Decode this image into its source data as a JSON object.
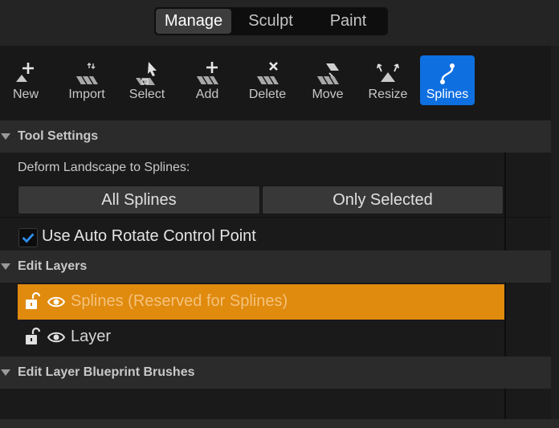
{
  "modes": {
    "items": [
      {
        "label": "Manage",
        "active": true
      },
      {
        "label": "Sculpt",
        "active": false
      },
      {
        "label": "Paint",
        "active": false
      }
    ]
  },
  "tools": [
    {
      "label": "New",
      "icon": "new-icon",
      "active": false
    },
    {
      "label": "Import",
      "icon": "import-icon",
      "active": false
    },
    {
      "label": "Select",
      "icon": "select-icon",
      "active": false
    },
    {
      "label": "Add",
      "icon": "add-icon",
      "active": false
    },
    {
      "label": "Delete",
      "icon": "delete-icon",
      "active": false
    },
    {
      "label": "Move",
      "icon": "move-icon",
      "active": false
    },
    {
      "label": "Resize",
      "icon": "resize-icon",
      "active": false
    },
    {
      "label": "Splines",
      "icon": "splines-icon",
      "active": true
    }
  ],
  "tool_settings": {
    "title": "Tool Settings",
    "deform_label": "Deform Landscape to Splines:",
    "all_splines": "All Splines",
    "only_selected": "Only Selected",
    "auto_rotate_label": "Use Auto Rotate Control Point",
    "auto_rotate_checked": true
  },
  "edit_layers": {
    "title": "Edit Layers",
    "layers": [
      {
        "name": "Splines (Reserved for Splines)",
        "selected": true,
        "locked": false,
        "visible": true
      },
      {
        "name": "Layer",
        "selected": false,
        "locked": false,
        "visible": true
      }
    ]
  },
  "blueprint_brushes": {
    "title": "Edit Layer Blueprint Brushes"
  },
  "colors": {
    "accent": "#0e6fe0",
    "selected_layer": "#e08a0e",
    "panel_bg": "#1a1a1a",
    "header_bg": "#2b2b2b"
  }
}
